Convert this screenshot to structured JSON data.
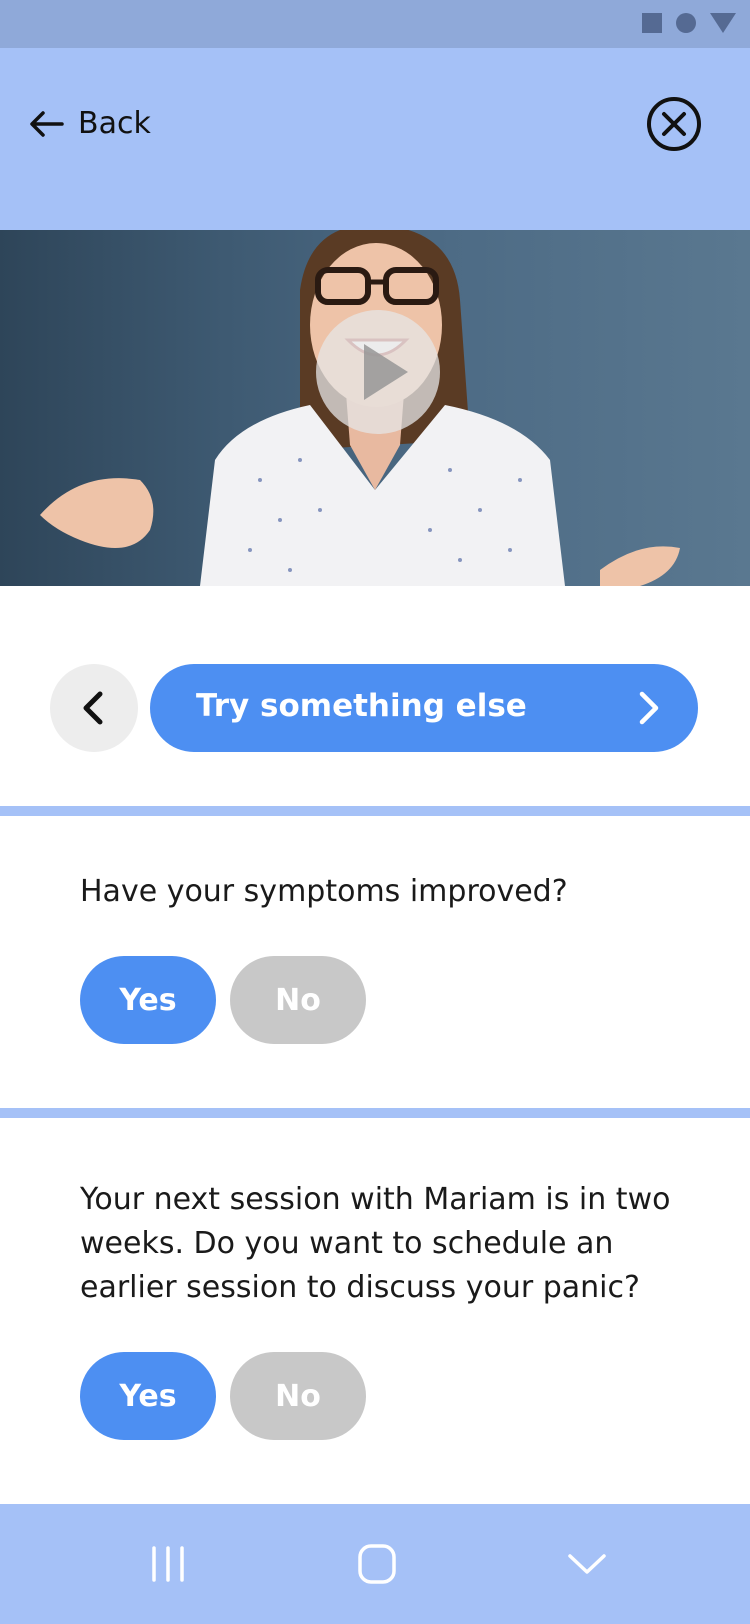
{
  "header": {
    "back_label": "Back"
  },
  "navigation": {
    "next_label": "Try something else"
  },
  "questions": [
    {
      "text": "Have your symptoms improved?",
      "yes_label": "Yes",
      "no_label": "No",
      "selected": "Yes"
    },
    {
      "text": "Your next session with Mariam is in two weeks. Do you want to schedule an earlier session to discuss your panic?",
      "yes_label": "Yes",
      "no_label": "No",
      "selected": "Yes"
    }
  ],
  "colors": {
    "accent": "#4d8ff2",
    "header_bg": "#a5c1f7",
    "status_bg": "#8fa9d9",
    "neutral_pill": "#c8c8c8"
  },
  "icons": {
    "back": "arrow-left-icon",
    "close": "close-circle-icon",
    "play": "play-icon",
    "prev": "chevron-left-icon",
    "next": "chevron-right-icon"
  }
}
